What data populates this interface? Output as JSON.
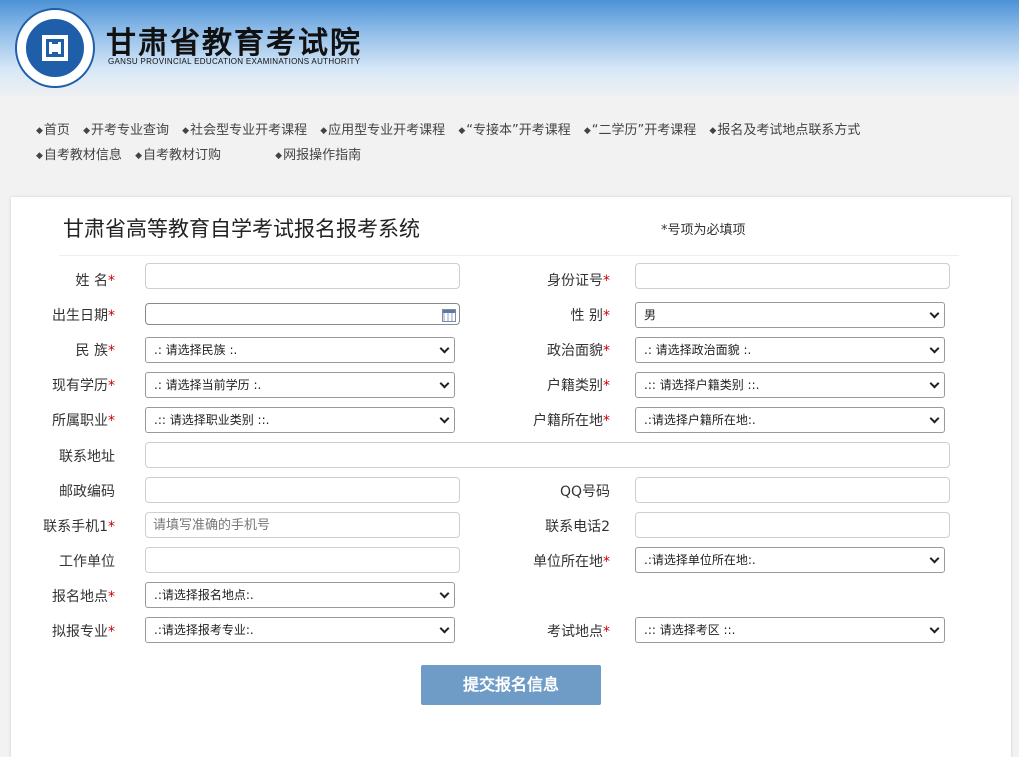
{
  "brand": {
    "title": "甘肃省教育考试院",
    "subtitle": "GANSU PROVINCIAL EDUCATION EXAMINATIONS AUTHORITY"
  },
  "nav": {
    "row1": [
      "首页",
      "开考专业查询",
      "社会型专业开考课程",
      "应用型专业开考课程",
      "“专接本”开考课程",
      "“二学历”开考课程",
      "报名及考试地点联系方式"
    ],
    "row2": [
      "自考教材信息",
      "自考教材订购",
      "网报操作指南"
    ]
  },
  "form": {
    "title": "甘肃省高等教育自学考试报名报考系统",
    "required_note": "*号项为必填项",
    "fields": {
      "name": {
        "label": "姓 名",
        "value": ""
      },
      "id_card": {
        "label": "身份证号",
        "value": ""
      },
      "birth_date": {
        "label": "出生日期",
        "value": ""
      },
      "gender": {
        "label": "性 别",
        "value": "男"
      },
      "ethnicity": {
        "label": "民 族",
        "value": ".: 请选择民族 :."
      },
      "political": {
        "label": "政治面貌",
        "value": ".: 请选择政治面貌 :."
      },
      "education": {
        "label": "现有学历",
        "value": ".: 请选择当前学历 :."
      },
      "household_type": {
        "label": "户籍类别",
        "value": ".:: 请选择户籍类别 ::."
      },
      "occupation": {
        "label": "所属职业",
        "value": ".:: 请选择职业类别 ::."
      },
      "household_location": {
        "label": "户籍所在地",
        "value": ".:请选择户籍所在地:."
      },
      "address": {
        "label": "联系地址",
        "value": ""
      },
      "postcode": {
        "label": "邮政编码",
        "value": ""
      },
      "qq": {
        "label": "QQ号码",
        "value": ""
      },
      "mobile": {
        "label": "联系手机1",
        "placeholder": "请填写准确的手机号"
      },
      "phone2": {
        "label": "联系电话2",
        "value": ""
      },
      "employer": {
        "label": "工作单位",
        "value": ""
      },
      "employer_location": {
        "label": "单位所在地",
        "value": ".:请选择单位所在地:."
      },
      "register_site": {
        "label": "报名地点",
        "value": ".:请选择报名地点:."
      },
      "major": {
        "label": "拟报专业",
        "value": ".:请选择报考专业:."
      },
      "exam_site": {
        "label": "考试地点",
        "value": ".:: 请选择考区 ::."
      }
    },
    "submit_label": "提交报名信息",
    "required_mark": "*"
  }
}
